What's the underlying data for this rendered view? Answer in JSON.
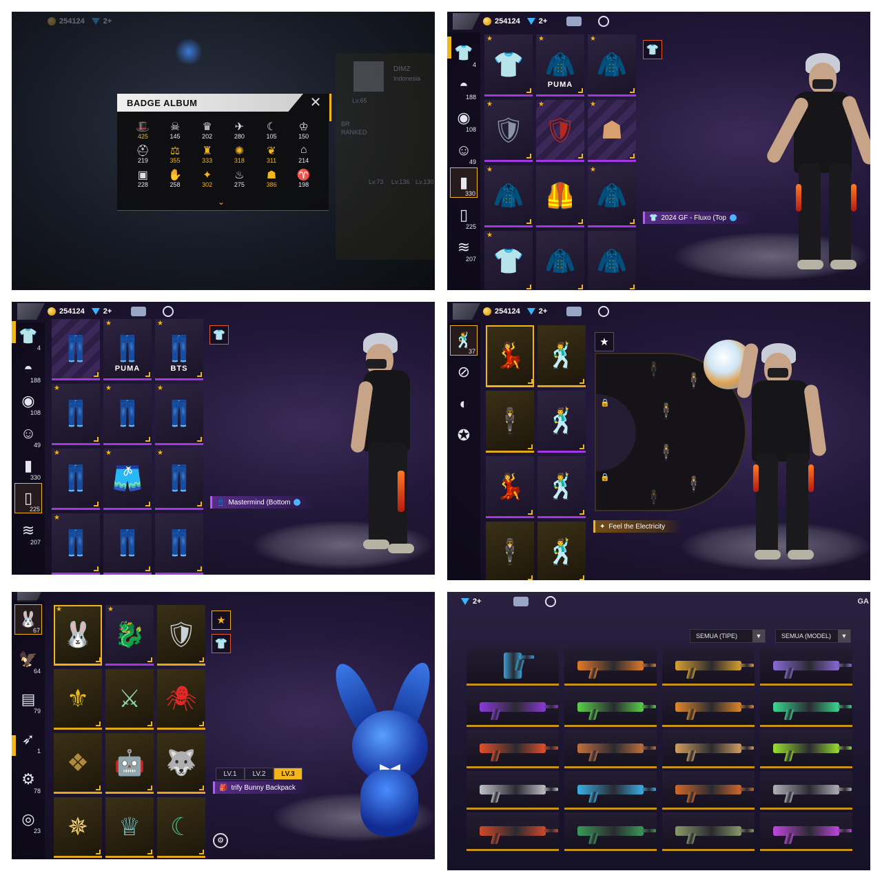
{
  "currency": {
    "coins": "254124",
    "diamonds": "2+"
  },
  "badge_album": {
    "title": "BADGE ALBUM",
    "badges": [
      {
        "count": "425",
        "icon": "hat-icon",
        "gold": true
      },
      {
        "count": "145",
        "icon": "skull-icon",
        "gold": false
      },
      {
        "count": "202",
        "icon": "mask-icon",
        "gold": false
      },
      {
        "count": "280",
        "icon": "bird-icon",
        "gold": false
      },
      {
        "count": "105",
        "icon": "moon-icon",
        "gold": false
      },
      {
        "count": "150",
        "icon": "crown-icon",
        "gold": false
      },
      {
        "count": "219",
        "icon": "helmet-icon",
        "gold": false
      },
      {
        "count": "355",
        "icon": "scale-icon",
        "gold": true
      },
      {
        "count": "333",
        "icon": "tower-icon",
        "gold": true
      },
      {
        "count": "318",
        "icon": "flame-icon",
        "gold": true
      },
      {
        "count": "311",
        "icon": "wing-icon",
        "gold": true
      },
      {
        "count": "214",
        "icon": "temple-icon",
        "gold": false
      },
      {
        "count": "228",
        "icon": "card-icon",
        "gold": false
      },
      {
        "count": "258",
        "icon": "claw-icon",
        "gold": false
      },
      {
        "count": "302",
        "icon": "eagle-icon",
        "gold": true
      },
      {
        "count": "275",
        "icon": "fire-icon",
        "gold": false
      },
      {
        "count": "386",
        "icon": "cake-icon",
        "gold": true
      },
      {
        "count": "198",
        "icon": "ram-icon",
        "gold": false
      }
    ],
    "bg_texts": {
      "name": "DIMZ",
      "region": "Indonesia",
      "level": "Lv.65",
      "rank_line1": "BR",
      "rank_line2": "RANKED",
      "lv1": "Lv.73",
      "lv2": "Lv.136",
      "lv3": "Lv.130"
    }
  },
  "outfit_categories": [
    {
      "icon": "outfit-icon",
      "count": "4"
    },
    {
      "icon": "hair-icon",
      "count": "188"
    },
    {
      "icon": "mask-icon",
      "count": "108"
    },
    {
      "icon": "face-icon",
      "count": "49"
    },
    {
      "icon": "top-icon",
      "count": "330"
    },
    {
      "icon": "bottom-icon",
      "count": "225"
    },
    {
      "icon": "shoes-icon",
      "count": "207"
    }
  ],
  "tops_panel": {
    "brand_labels": [
      "PUMA"
    ],
    "selected_name": "2024 GF - Fluxo (Top"
  },
  "bottoms_panel": {
    "brand_labels": [
      "PUMA",
      "BTS"
    ],
    "selected_name": "Mastermind (Bottom"
  },
  "emote_panel": {
    "category_count": "37",
    "selected_name": "Feel the Electricity"
  },
  "backpack_panel": {
    "categories": [
      {
        "icon": "bunny-icon",
        "count": "67"
      },
      {
        "icon": "bird-icon",
        "count": "64"
      },
      {
        "icon": "box-icon",
        "count": "79"
      },
      {
        "icon": "wing-icon",
        "count": "1"
      },
      {
        "icon": "gear-icon",
        "count": "78"
      },
      {
        "icon": "disc-icon",
        "count": "23"
      }
    ],
    "level_tabs": [
      "LV.1",
      "LV.2",
      "LV.3"
    ],
    "active_level": "LV.3",
    "selected_name": "trify Bunny Backpack"
  },
  "weapon_panel": {
    "filter_type": "SEMUA (TIPE)",
    "filter_model": "SEMUA (MODEL)",
    "corner_text": "GA",
    "weapon_colors": [
      "#3aa0d8",
      "#e07a2a",
      "#d8a030",
      "#8a6ad8",
      "#8a3ad8",
      "#5ad04a",
      "#e0882a",
      "#3ad890",
      "#e0502a",
      "#c07040",
      "#d0a060",
      "#9ae030",
      "#c0c0c8",
      "#3ab0e8",
      "#d06a2a",
      "#b0b0b8",
      "#d04a2a",
      "#3a9a5a",
      "#8a9a6a",
      "#c048e0"
    ]
  }
}
